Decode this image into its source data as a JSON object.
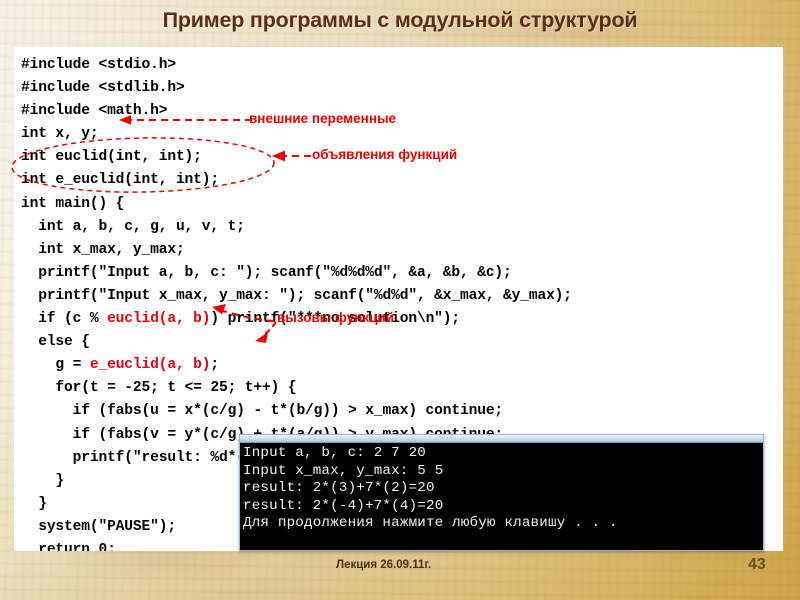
{
  "slide": {
    "title": "Пример программы с модульной структурой",
    "footer_text": "Лекция 26.09.11г.",
    "page_number": "43",
    "title_color": "#5a2d16",
    "accent_color": "#ee0000",
    "panel_color": "#ffffff",
    "background_color": "#ddc289"
  },
  "code": {
    "language": "C",
    "text": "#include <stdio.h>\n#include <stdlib.h>\n#include <math.h>\nint x, y;\nint euclid(int, int);\nint e_euclid(int, int);\nint main() {\n  int a, b, c, g, u, v, t;\n  int x_max, y_max;\n  printf(\"Input a, b, c: \"); scanf(\"%d%d%d\", &a, &b, &c);\n  printf(\"Input x_max, y_max: \"); scanf(\"%d%d\", &x_max, &y_max);\n  if (c % euclid(a, b)) printf(\"***no solution\\n\");\n  else {\n    g = e_euclid(a, b);\n    for(t = -25; t <= 25; t++) {\n      if (fabs(u = x*(c/g) - t*(b/g)) > x_max) continue;\n      if (fabs(v = y*(c/g) + t*(a/g)) > y_max) continue;\n      printf(\"result: %d*(%d)+%d*(%d)=%d\\n\", a, u, b, v, c);\n    }\n  }\n  system(\"PAUSE\");\n  return 0;\n}",
    "lines": [
      "#include <stdio.h>",
      "#include <stdlib.h>",
      "#include <math.h>",
      "int x, y;",
      "int euclid(int, int);",
      "int e_euclid(int, int);",
      "int main() {",
      "  int a, b, c, g, u, v, t;",
      "  int x_max, y_max;",
      "  printf(\"Input a, b, c: \"); scanf(\"%d%d%d\", &a, &b, &c);",
      "  printf(\"Input x_max, y_max: \"); scanf(\"%d%d\", &x_max, &y_max);",
      "  if (c % euclid(a, b)) printf(\"***no solution\\n\");",
      "  else {",
      "    g = e_euclid(a, b);",
      "    for(t = -25; t <= 25; t++) {",
      "      if (fabs(u = x*(c/g) - t*(b/g)) > x_max) continue;",
      "      if (fabs(v = y*(c/g) + t*(a/g)) > y_max) continue;",
      "      printf(\"result: %d*(%d)+%d*(%d)=%d\\n\", a, u, b, v, c);",
      "    }",
      "  }",
      "  system(\"PAUSE\");",
      "  return 0;",
      "}"
    ],
    "highlighted_calls": [
      "euclid(a, b)",
      "e_euclid(a, b)"
    ]
  },
  "annotations": [
    {
      "id": "vars",
      "label": "внешние переменные",
      "target_line": "int x, y;"
    },
    {
      "id": "decls",
      "label": "объявления функций",
      "target_line": "int euclid(int, int); / int e_euclid(int, int);"
    },
    {
      "id": "calls",
      "label": "вызовы функций",
      "target_line": "euclid(a, b) / e_euclid(a, b)"
    }
  ],
  "console": {
    "output": "Input a, b, c: 2 7 20\nInput x_max, y_max: 5 5\nresult: 2*(3)+7*(2)=20\nresult: 2*(-4)+7*(4)=20\nДля продолжения нажмите любую клавишу . . .",
    "lines": [
      "Input a, b, c: 2 7 20",
      "Input x_max, y_max: 5 5",
      "result: 2*(3)+7*(2)=20",
      "result: 2*(-4)+7*(4)=20",
      "Для продолжения нажмите любую клавишу . . ."
    ],
    "background_color": "#000000",
    "text_color": "#f2f2f2"
  }
}
